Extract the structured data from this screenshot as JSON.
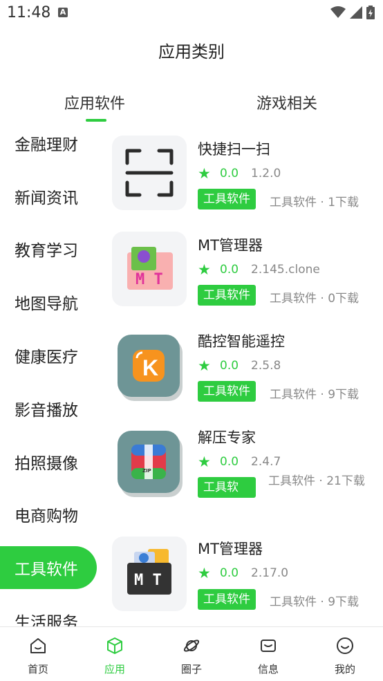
{
  "status_bar": {
    "time": "11:48",
    "indicator": "A"
  },
  "page": {
    "title": "应用类别"
  },
  "tabs": [
    {
      "label": "应用软件",
      "active": true
    },
    {
      "label": "游戏相关",
      "active": false
    }
  ],
  "categories": [
    {
      "label": "金融理财"
    },
    {
      "label": "新闻资讯"
    },
    {
      "label": "教育学习"
    },
    {
      "label": "地图导航"
    },
    {
      "label": "健康医疗"
    },
    {
      "label": "影音播放"
    },
    {
      "label": "拍照摄像"
    },
    {
      "label": "电商购物"
    },
    {
      "label": "工具软件",
      "active": true
    },
    {
      "label": "生活服务"
    }
  ],
  "apps": [
    {
      "name": "快捷扫一扫",
      "score": "0.0",
      "version": "1.2.0",
      "tag": "工具软件",
      "meta": "工具软件 · 1下载"
    },
    {
      "name": "MT管理器",
      "score": "0.0",
      "version": "2.145.clone",
      "tag": "工具软件",
      "meta": "工具软件 · 0下载"
    },
    {
      "name": "酷控智能遥控",
      "score": "0.0",
      "version": "2.5.8",
      "tag": "工具软件",
      "meta": "工具软件 · 9下载"
    },
    {
      "name": "解压专家",
      "score": "0.0",
      "version": "2.4.7",
      "tag": "工具软",
      "meta": "工具软件 · 21下载"
    },
    {
      "name": "MT管理器",
      "score": "0.0",
      "version": "2.17.0",
      "tag": "工具软件",
      "meta": "工具软件 · 9下载"
    }
  ],
  "icon_text": {
    "mt": "M T",
    "kukong": "K",
    "zip": "ZIP"
  },
  "bottom_nav": [
    {
      "label": "首页",
      "icon": "home-icon"
    },
    {
      "label": "应用",
      "icon": "apps-cube-icon",
      "active": true
    },
    {
      "label": "圈子",
      "icon": "planet-icon"
    },
    {
      "label": "信息",
      "icon": "message-icon"
    },
    {
      "label": "我的",
      "icon": "profile-icon"
    }
  ],
  "colors": {
    "accent": "#2ecc40",
    "text": "#222222",
    "muted": "#888888"
  }
}
